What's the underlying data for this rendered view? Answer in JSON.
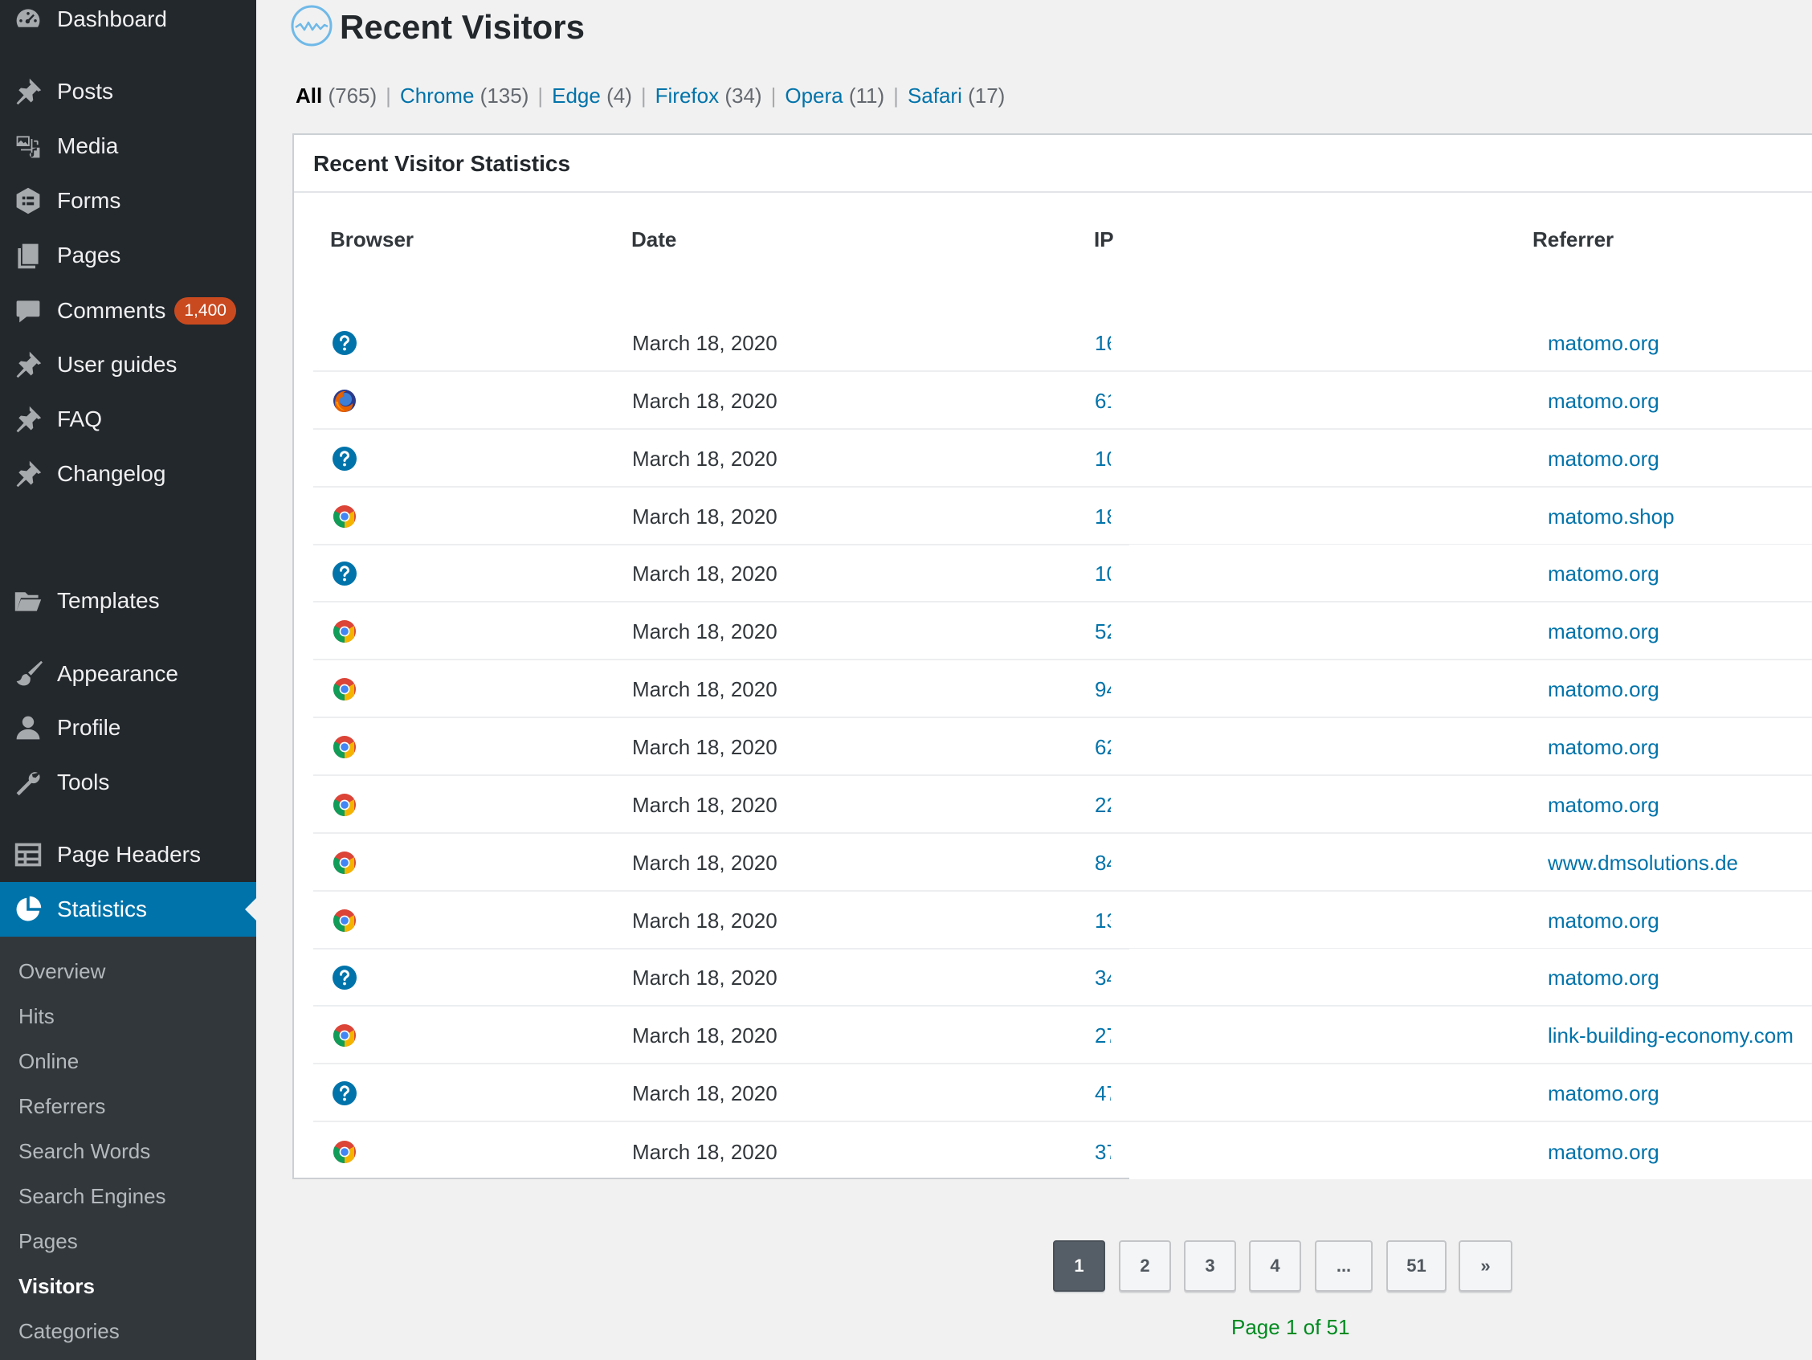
{
  "sidebar": {
    "items": [
      {
        "label": "Dashboard",
        "icon": "dashboard-icon"
      },
      {
        "label": "Posts",
        "icon": "pin-icon"
      },
      {
        "label": "Media",
        "icon": "media-icon"
      },
      {
        "label": "Forms",
        "icon": "forms-icon"
      },
      {
        "label": "Pages",
        "icon": "pages-icon"
      },
      {
        "label": "Comments",
        "icon": "comment-icon",
        "badge": "1,400"
      },
      {
        "label": "User guides",
        "icon": "pin-icon"
      },
      {
        "label": "FAQ",
        "icon": "pin-icon"
      },
      {
        "label": "Changelog",
        "icon": "pin-icon"
      },
      {
        "label": "Templates",
        "icon": "folder-icon"
      },
      {
        "label": "Appearance",
        "icon": "paintbrush-icon"
      },
      {
        "label": "Profile",
        "icon": "user-icon"
      },
      {
        "label": "Tools",
        "icon": "wrench-icon"
      },
      {
        "label": "Page Headers",
        "icon": "table-icon"
      },
      {
        "label": "Statistics",
        "icon": "pie-chart-icon",
        "current": true
      }
    ],
    "submenu": [
      {
        "label": "Overview"
      },
      {
        "label": "Hits"
      },
      {
        "label": "Online"
      },
      {
        "label": "Referrers"
      },
      {
        "label": "Search Words"
      },
      {
        "label": "Search Engines"
      },
      {
        "label": "Pages"
      },
      {
        "label": "Visitors",
        "active": true
      },
      {
        "label": "Categories"
      }
    ]
  },
  "page": {
    "title": "Recent Visitors",
    "title_icon": "visitors-wave-icon"
  },
  "filters": [
    {
      "label": "All",
      "count": "(765)",
      "current": true
    },
    {
      "label": "Chrome",
      "count": "(135)"
    },
    {
      "label": "Edge",
      "count": "(4)"
    },
    {
      "label": "Firefox",
      "count": "(34)"
    },
    {
      "label": "Opera",
      "count": "(11)"
    },
    {
      "label": "Safari",
      "count": "(17)"
    }
  ],
  "filter_separator": "|",
  "panel": {
    "title": "Recent Visitor Statistics",
    "columns": [
      "Browser",
      "Date",
      "IP",
      "Referrer"
    ],
    "rows": [
      {
        "browser": "unknown",
        "date": "March 18, 2020",
        "ip": "16",
        "referrer": "matomo.org"
      },
      {
        "browser": "firefox",
        "date": "March 18, 2020",
        "ip": "61",
        "referrer": "matomo.org"
      },
      {
        "browser": "unknown",
        "date": "March 18, 2020",
        "ip": "10",
        "referrer": "matomo.org"
      },
      {
        "browser": "chrome",
        "date": "March 18, 2020",
        "ip": "18",
        "referrer": "matomo.shop"
      },
      {
        "browser": "unknown",
        "date": "March 18, 2020",
        "ip": "10",
        "referrer": "matomo.org"
      },
      {
        "browser": "chrome",
        "date": "March 18, 2020",
        "ip": "52",
        "referrer": "matomo.org"
      },
      {
        "browser": "chrome",
        "date": "March 18, 2020",
        "ip": "94",
        "referrer": "matomo.org"
      },
      {
        "browser": "chrome",
        "date": "March 18, 2020",
        "ip": "62",
        "referrer": "matomo.org"
      },
      {
        "browser": "chrome",
        "date": "March 18, 2020",
        "ip": "22",
        "referrer": "matomo.org"
      },
      {
        "browser": "chrome",
        "date": "March 18, 2020",
        "ip": "84",
        "referrer": "www.dmsolutions.de"
      },
      {
        "browser": "chrome",
        "date": "March 18, 2020",
        "ip": "13",
        "referrer": "matomo.org"
      },
      {
        "browser": "unknown",
        "date": "March 18, 2020",
        "ip": "34",
        "referrer": "matomo.org"
      },
      {
        "browser": "chrome",
        "date": "March 18, 2020",
        "ip": "27",
        "referrer": "link-building-economy.com"
      },
      {
        "browser": "unknown",
        "date": "March 18, 2020",
        "ip": "47",
        "referrer": "matomo.org"
      },
      {
        "browser": "chrome",
        "date": "March 18, 2020",
        "ip": "37",
        "referrer": "matomo.org"
      }
    ]
  },
  "pagination": {
    "buttons": [
      {
        "label": "1",
        "current": true
      },
      {
        "label": "2"
      },
      {
        "label": "3"
      },
      {
        "label": "4"
      },
      {
        "label": "..."
      },
      {
        "label": "51"
      },
      {
        "label": "»"
      }
    ],
    "status": "Page 1 of 51"
  },
  "colors": {
    "sidebar_bg": "#23282d",
    "submenu_bg": "#32373c",
    "accent": "#0073aa",
    "badge": "#ca4a1f",
    "status_text": "#008a20"
  }
}
